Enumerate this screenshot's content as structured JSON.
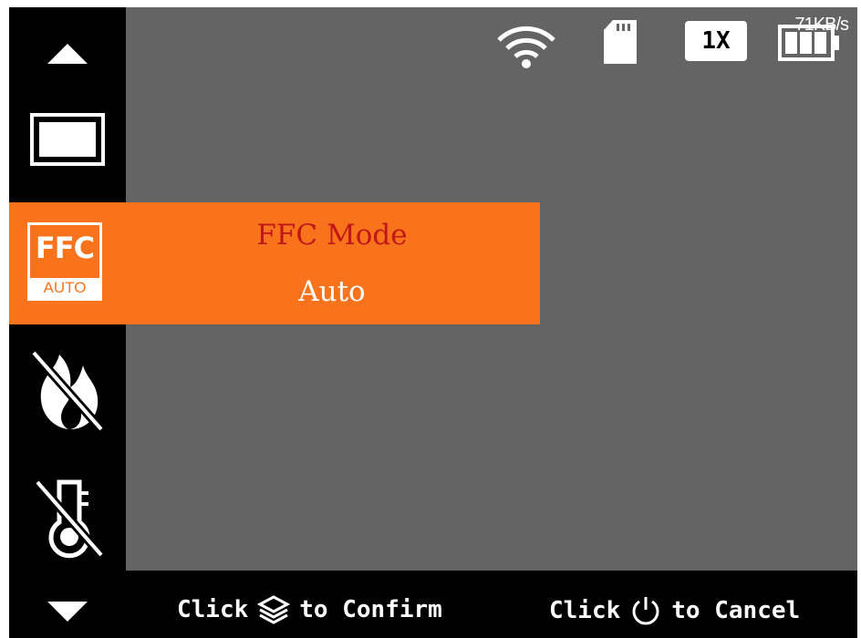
{
  "status_bar": {
    "zoom": "1X",
    "transfer_speed": "71KB/s",
    "icons": [
      "wifi-icon",
      "sd-card-icon",
      "battery-icon"
    ]
  },
  "sidebar": {
    "items": [
      "up-arrow-icon",
      "display-mode-icon",
      "ffc-auto-icon",
      "fire-off-icon",
      "temperature-off-icon",
      "down-arrow-icon"
    ],
    "ffc_icon_label": "FFC",
    "ffc_icon_sublabel": "AUTO"
  },
  "menu": {
    "title": "FFC Mode",
    "value": "Auto"
  },
  "bottom_bar": {
    "confirm_prefix": "Click",
    "confirm_suffix": "to Confirm",
    "cancel_prefix": "Click",
    "cancel_suffix": "to Cancel"
  },
  "colors": {
    "accent": "#f9731d",
    "title_text": "#c01818",
    "viewport": "#646464"
  }
}
